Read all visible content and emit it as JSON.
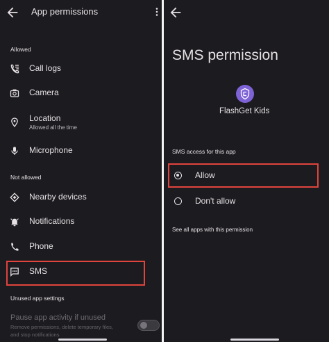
{
  "left": {
    "title": "App permissions",
    "allowed_header": "Allowed",
    "allowed": [
      {
        "label": "Call logs",
        "icon": "call-log-icon"
      },
      {
        "label": "Camera",
        "icon": "camera-icon"
      },
      {
        "label": "Location",
        "sub": "Allowed all the time",
        "icon": "location-icon"
      },
      {
        "label": "Microphone",
        "icon": "microphone-icon"
      }
    ],
    "not_allowed_header": "Not allowed",
    "not_allowed": [
      {
        "label": "Nearby devices",
        "icon": "nearby-devices-icon"
      },
      {
        "label": "Notifications",
        "icon": "notifications-icon"
      },
      {
        "label": "Phone",
        "icon": "phone-icon"
      },
      {
        "label": "SMS",
        "icon": "sms-icon",
        "highlighted": true
      }
    ],
    "unused_header": "Unused app settings",
    "pause": {
      "label": "Pause app activity if unused",
      "sub1": "Remove permissions, delete temporary files,",
      "sub2": "and stop notifications",
      "enabled": false
    }
  },
  "right": {
    "title": "SMS permission",
    "app_name": "FlashGet Kids",
    "section": "SMS access for this app",
    "options": [
      {
        "label": "Allow",
        "selected": true,
        "highlighted": true
      },
      {
        "label": "Don't allow",
        "selected": false
      }
    ],
    "see_all": "See all apps with this permission"
  },
  "colors": {
    "background": "#1c1b1f",
    "text": "#e6e1e5",
    "highlight": "#e0443e",
    "app_icon": "#7e63d6"
  }
}
